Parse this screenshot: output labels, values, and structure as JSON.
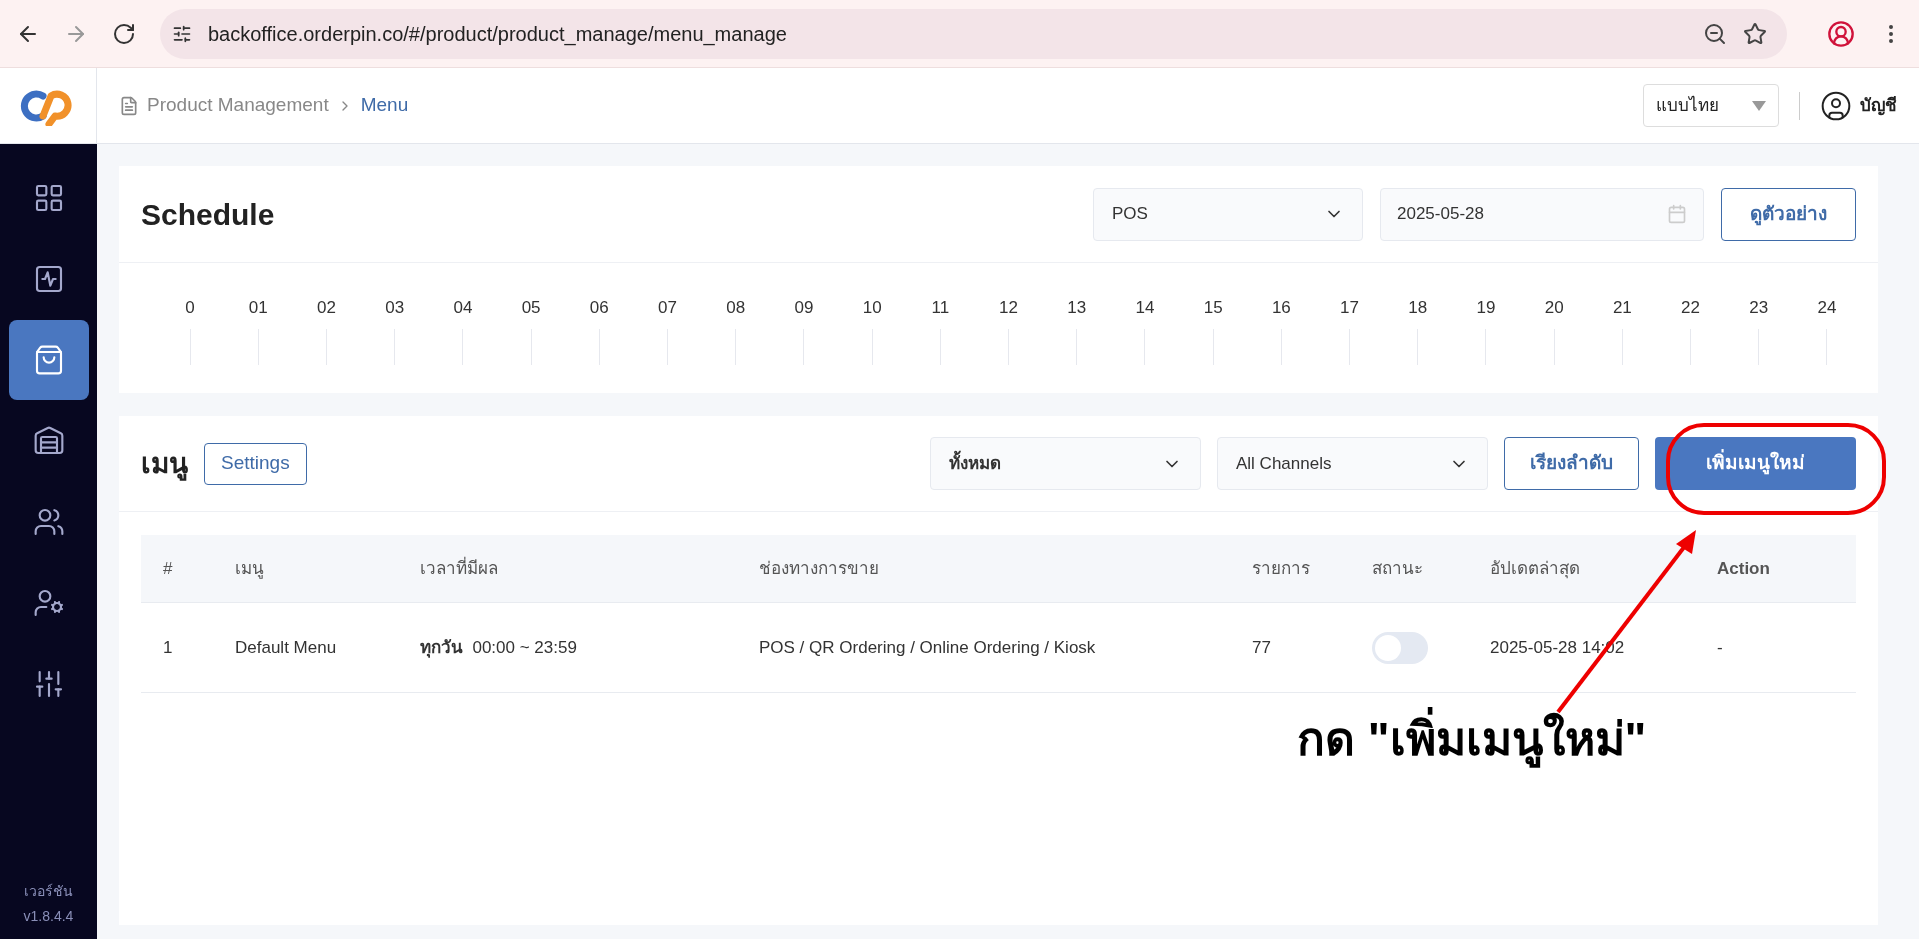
{
  "browser": {
    "url": "backoffice.orderpin.co/#/product/product_manage/menu_manage"
  },
  "breadcrumb": [
    {
      "label": "Product Management",
      "selected": false
    },
    {
      "label": "Menu",
      "selected": true
    }
  ],
  "header": {
    "language_select": "แบบไทย",
    "account": "บัญชี"
  },
  "sidebar": {
    "items": [
      {
        "selected": false
      },
      {
        "selected": false
      },
      {
        "selected": true
      },
      {
        "selected": false
      },
      {
        "selected": false
      },
      {
        "selected": false
      },
      {
        "selected": false
      }
    ],
    "version_label": "เวอร์ชัน",
    "version": "v1.8.4.4"
  },
  "schedule": {
    "title": "Schedule",
    "channel_select": "POS",
    "date": "2025-05-28",
    "preview_button": "ดูตัวอย่าง",
    "hours": [
      "0",
      "01",
      "02",
      "03",
      "04",
      "05",
      "06",
      "07",
      "08",
      "09",
      "10",
      "11",
      "12",
      "13",
      "14",
      "15",
      "16",
      "17",
      "18",
      "19",
      "20",
      "21",
      "22",
      "23",
      "24"
    ]
  },
  "menu_section": {
    "title": "เมนู",
    "settings_button": "Settings",
    "filter_select": "ทั้งหมด",
    "channel_select": "All Channels",
    "sort_button": "เรียงลำดับ",
    "add_button": "เพิ่มเมนูใหม่"
  },
  "table": {
    "columns": [
      "#",
      "เมนู",
      "เวลาที่มีผล",
      "ช่องทางการขาย",
      "รายการ",
      "สถานะ",
      "อัปเดตล่าสุด",
      "Action"
    ],
    "rows": [
      {
        "index": "1",
        "name": "Default Menu",
        "days": "ทุกวัน",
        "time": "00:00 ~ 23:59",
        "channels": "POS / QR Ordering / Online Ordering / Kiosk",
        "items": "77",
        "on": false,
        "updated": "2025-05-28 14:02",
        "action": "-"
      }
    ]
  },
  "annotation": {
    "text": "กด \"เพิ่มเมนูใหม่\""
  }
}
